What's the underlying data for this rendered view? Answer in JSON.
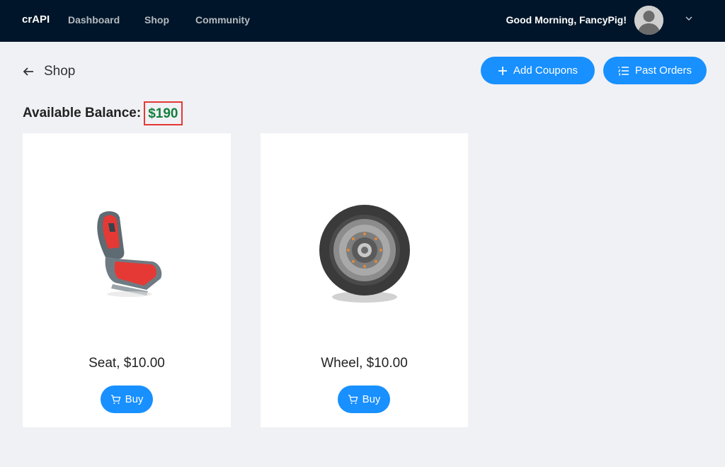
{
  "topbar": {
    "brand": "crAPI",
    "nav": [
      "Dashboard",
      "Shop",
      "Community"
    ],
    "greeting": "Good Morning, FancyPig!",
    "chevron_icon": "chevron-down-icon",
    "background": "#001529"
  },
  "page": {
    "title": "Shop",
    "back_icon": "arrow-left-icon"
  },
  "actions": {
    "add_coupons": "Add Coupons",
    "past_orders": "Past Orders",
    "accent": "#1890ff"
  },
  "balance": {
    "label": "Available Balance:",
    "value": "$190",
    "value_color": "#15803d",
    "highlight_color": "#e53935"
  },
  "products": [
    {
      "caption": "Seat, $10.00",
      "buy_label": "Buy",
      "image": "car-seat"
    },
    {
      "caption": "Wheel, $10.00",
      "buy_label": "Buy",
      "image": "wheel"
    }
  ]
}
